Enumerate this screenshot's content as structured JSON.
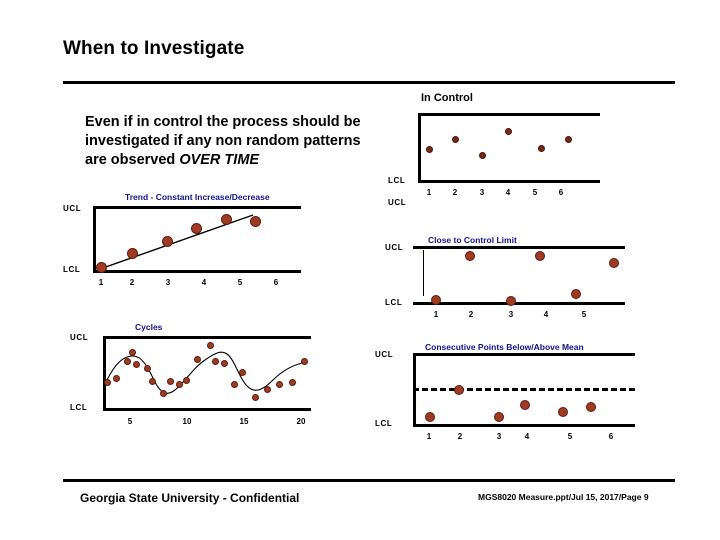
{
  "slide": {
    "title": "When to Investigate",
    "body_text_1": "Even if in control the process should be investigated if any non random patterns are observed ",
    "body_text_emphasis": "OVER TIME",
    "footer_left": "Georgia State University - Confidential",
    "footer_right": "MGS8020 Measure.ppt/Jul 15, 2017/Page 9"
  },
  "labels": {
    "ucl": "UCL",
    "lcl": "LCL"
  },
  "colors": {
    "marker": "#9E3B24",
    "marker_dark": "#7A2718",
    "title_blue": "#12128C",
    "axis": "#000000"
  },
  "chart_data": [
    {
      "id": "in-control",
      "type": "scatter",
      "title": "In Control",
      "title_color": "#000000",
      "xlabel": "",
      "ylabel": "",
      "ylim": [
        0,
        1
      ],
      "ytick_labels": [
        "UCL",
        "LCL"
      ],
      "categories": [
        "1",
        "2",
        "3",
        "4",
        "5",
        "6"
      ],
      "x": [
        1,
        2,
        3,
        4,
        5,
        6
      ],
      "values": [
        0.42,
        0.58,
        0.33,
        0.7,
        0.45,
        0.62
      ],
      "grid": false,
      "legend": "none",
      "annotations": []
    },
    {
      "id": "trend",
      "type": "scatter",
      "title": "Trend - Constant Increase/Decrease",
      "title_color": "#12128C",
      "xlabel": "",
      "ylabel": "",
      "ylim": [
        0,
        1
      ],
      "ytick_labels": [
        "UCL",
        "LCL"
      ],
      "categories": [
        "1",
        "2",
        "3",
        "4",
        "5",
        "6"
      ],
      "x": [
        1.05,
        2.05,
        3.0,
        3.6,
        4.45,
        5.35
      ],
      "values": [
        0.06,
        0.3,
        0.48,
        0.68,
        0.83,
        0.8
      ],
      "trendline": {
        "x0": 1.05,
        "y0": 0.05,
        "x1": 5.2,
        "y1": 0.88
      },
      "grid": false,
      "legend": "none",
      "annotations": []
    },
    {
      "id": "close-to-control-limit",
      "type": "scatter",
      "title": "Close to Control Limit",
      "title_color": "#12128C",
      "xlabel": "",
      "ylabel": "",
      "ylim": [
        0,
        1
      ],
      "ytick_labels": [
        "UCL",
        "LCL"
      ],
      "categories": [
        "1",
        "2",
        "3",
        "4",
        "5"
      ],
      "x": [
        1.0,
        1.95,
        3.0,
        3.75,
        4.7,
        5.75
      ],
      "values": [
        0.07,
        0.86,
        0.08,
        0.86,
        0.18,
        0.76
      ],
      "grid": false,
      "legend": "none",
      "annotations": []
    },
    {
      "id": "cycles",
      "type": "scatter",
      "title": "Cycles",
      "title_color": "#12128C",
      "xlabel": "",
      "ylabel": "",
      "ylim": [
        0,
        1
      ],
      "ytick_labels": [
        "UCL",
        "LCL"
      ],
      "categories": [
        "5",
        "10",
        "15",
        "20"
      ],
      "x": [
        2.4,
        3.5,
        4.3,
        5.0,
        5.2,
        6.4,
        6.7,
        7.9,
        8.9,
        9.6,
        10.2,
        11.2,
        12.3,
        12.8,
        13.4,
        14.4,
        14.8,
        16.2,
        16.8,
        18.1,
        19.4,
        20.6
      ],
      "values": [
        0.46,
        0.4,
        0.66,
        0.8,
        0.63,
        0.58,
        0.42,
        0.27,
        0.38,
        0.35,
        0.42,
        0.73,
        0.92,
        0.66,
        0.64,
        0.38,
        0.53,
        0.23,
        0.27,
        0.37,
        0.4,
        0.66
      ],
      "fitline": "sine wave through points",
      "grid": false,
      "legend": "none",
      "annotations": []
    },
    {
      "id": "consecutive-points",
      "type": "scatter",
      "title": "Consecutive Points Below/Above Mean",
      "title_color": "#12128C",
      "xlabel": "",
      "ylabel": "",
      "ylim": [
        0,
        1
      ],
      "ytick_labels": [
        "UCL",
        "LCL"
      ],
      "categories": [
        "1",
        "2",
        "3",
        "4",
        "5",
        "6"
      ],
      "x": [
        1.1,
        2.05,
        3.0,
        3.85,
        4.8,
        5.55
      ],
      "values": [
        0.12,
        0.47,
        0.12,
        0.27,
        0.18,
        0.23
      ],
      "mean_line": {
        "y": 0.5,
        "style": "dashed"
      },
      "grid": false,
      "legend": "none",
      "annotations": []
    }
  ]
}
